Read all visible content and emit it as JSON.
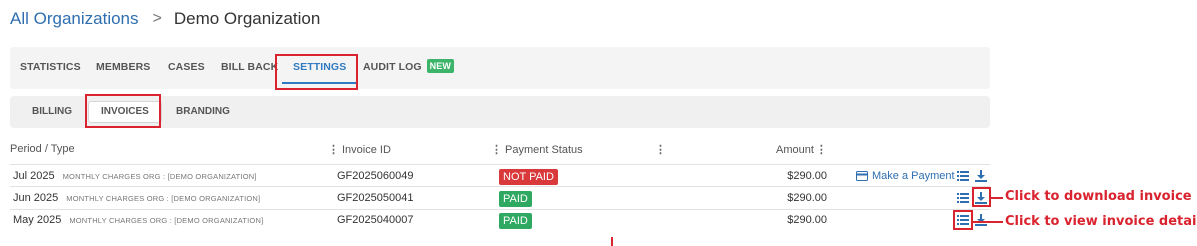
{
  "breadcrumb": {
    "root": "All Organizations",
    "separator": ">",
    "current": "Demo Organization"
  },
  "tabs": {
    "statistics": "STATISTICS",
    "members": "MEMBERS",
    "cases": "CASES",
    "bill_back": "BILL BACK",
    "settings": "SETTINGS",
    "audit_log": "AUDIT LOG",
    "new_badge": "NEW"
  },
  "subtabs": {
    "billing": "BILLING",
    "invoices": "INVOICES",
    "branding": "BRANDING"
  },
  "table": {
    "headers": {
      "period": "Period / Type",
      "invoice_id": "Invoice ID",
      "payment_status": "Payment Status",
      "amount": "Amount"
    },
    "rows": [
      {
        "period": "Jul 2025",
        "type": "MONTHLY CHARGES ORG : [DEMO ORGANIZATION]",
        "invoice_id": "GF2025060049",
        "status": "NOT PAID",
        "amount": "$290.00",
        "action": "Make a Payment"
      },
      {
        "period": "Jun 2025",
        "type": "MONTHLY CHARGES ORG : [DEMO ORGANIZATION]",
        "invoice_id": "GF2025050041",
        "status": "PAID",
        "amount": "$290.00"
      },
      {
        "period": "May 2025",
        "type": "MONTHLY CHARGES ORG : [DEMO ORGANIZATION]",
        "invoice_id": "GF2025040007",
        "status": "PAID",
        "amount": "$290.00"
      }
    ]
  },
  "annotations": {
    "download": "Click to download invoice",
    "details": "Click to view invoice details"
  },
  "colors": {
    "accent": "#2f7ac0",
    "link": "#2f6fb0",
    "highlight": "#d9232e",
    "paid": "#2fa862",
    "unpaid": "#d9393a"
  }
}
